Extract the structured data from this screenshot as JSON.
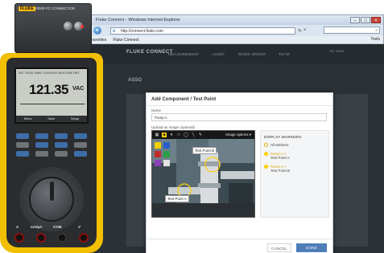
{
  "browser": {
    "title": "Fluke Connect - Windows Internet Explorer",
    "url": "http://connect.fluke.com",
    "favorites_label": "Favorites",
    "tab_label": "Fluke Connect",
    "tools_label": "Tools"
  },
  "app": {
    "logo": "FLUKE CONNECT",
    "nav": [
      "MEASUREMENT",
      "ASSET",
      "WORK ORDER",
      "TEAM"
    ],
    "user": "Hi, User",
    "sub_heading": "ASSO"
  },
  "modal": {
    "title": "Add Component / Test Point",
    "name_label": "Name",
    "name_value": "Pump A",
    "upload_label": "Upload an image (optional)",
    "image_options": "Image options ▾",
    "tools": [
      "▦",
      "■",
      "▾",
      "□",
      "◯",
      "╲",
      "✎"
    ],
    "palette": [
      "#f0d000",
      "#2a5fc9",
      "#c42a2a",
      "#2aa046",
      "#8a3fb4",
      "#e2e2e2"
    ],
    "tags": [
      "Test Point B",
      "Test Point A"
    ],
    "markers_heading": "DISPLAY MARKERS:",
    "markers": [
      {
        "label": "All Markers",
        "sub": ""
      },
      {
        "label": "Test Point A",
        "sub": "Pump A >"
      },
      {
        "label": "Test Point B",
        "sub": "Pump A >"
      }
    ],
    "cancel_label": "CANCEL",
    "done_label": "DONE"
  },
  "meter": {
    "connector_brand": "FLUKE",
    "connector_model": "ir3000 FC CONNECTOR",
    "lcd_header": "287 TRUE RMS LOGGING MULTIMETER",
    "reading": "121.35",
    "unit": "VAC",
    "softkeys": [
      "Menu",
      "Save",
      "Setup"
    ],
    "jack_labels": [
      "A",
      "mA/µA",
      "COM",
      "V"
    ]
  },
  "colors": {
    "fluke_yellow": "#f2c000",
    "done_button": "#4f7db8",
    "marker_yellow": "#ffcf00"
  }
}
